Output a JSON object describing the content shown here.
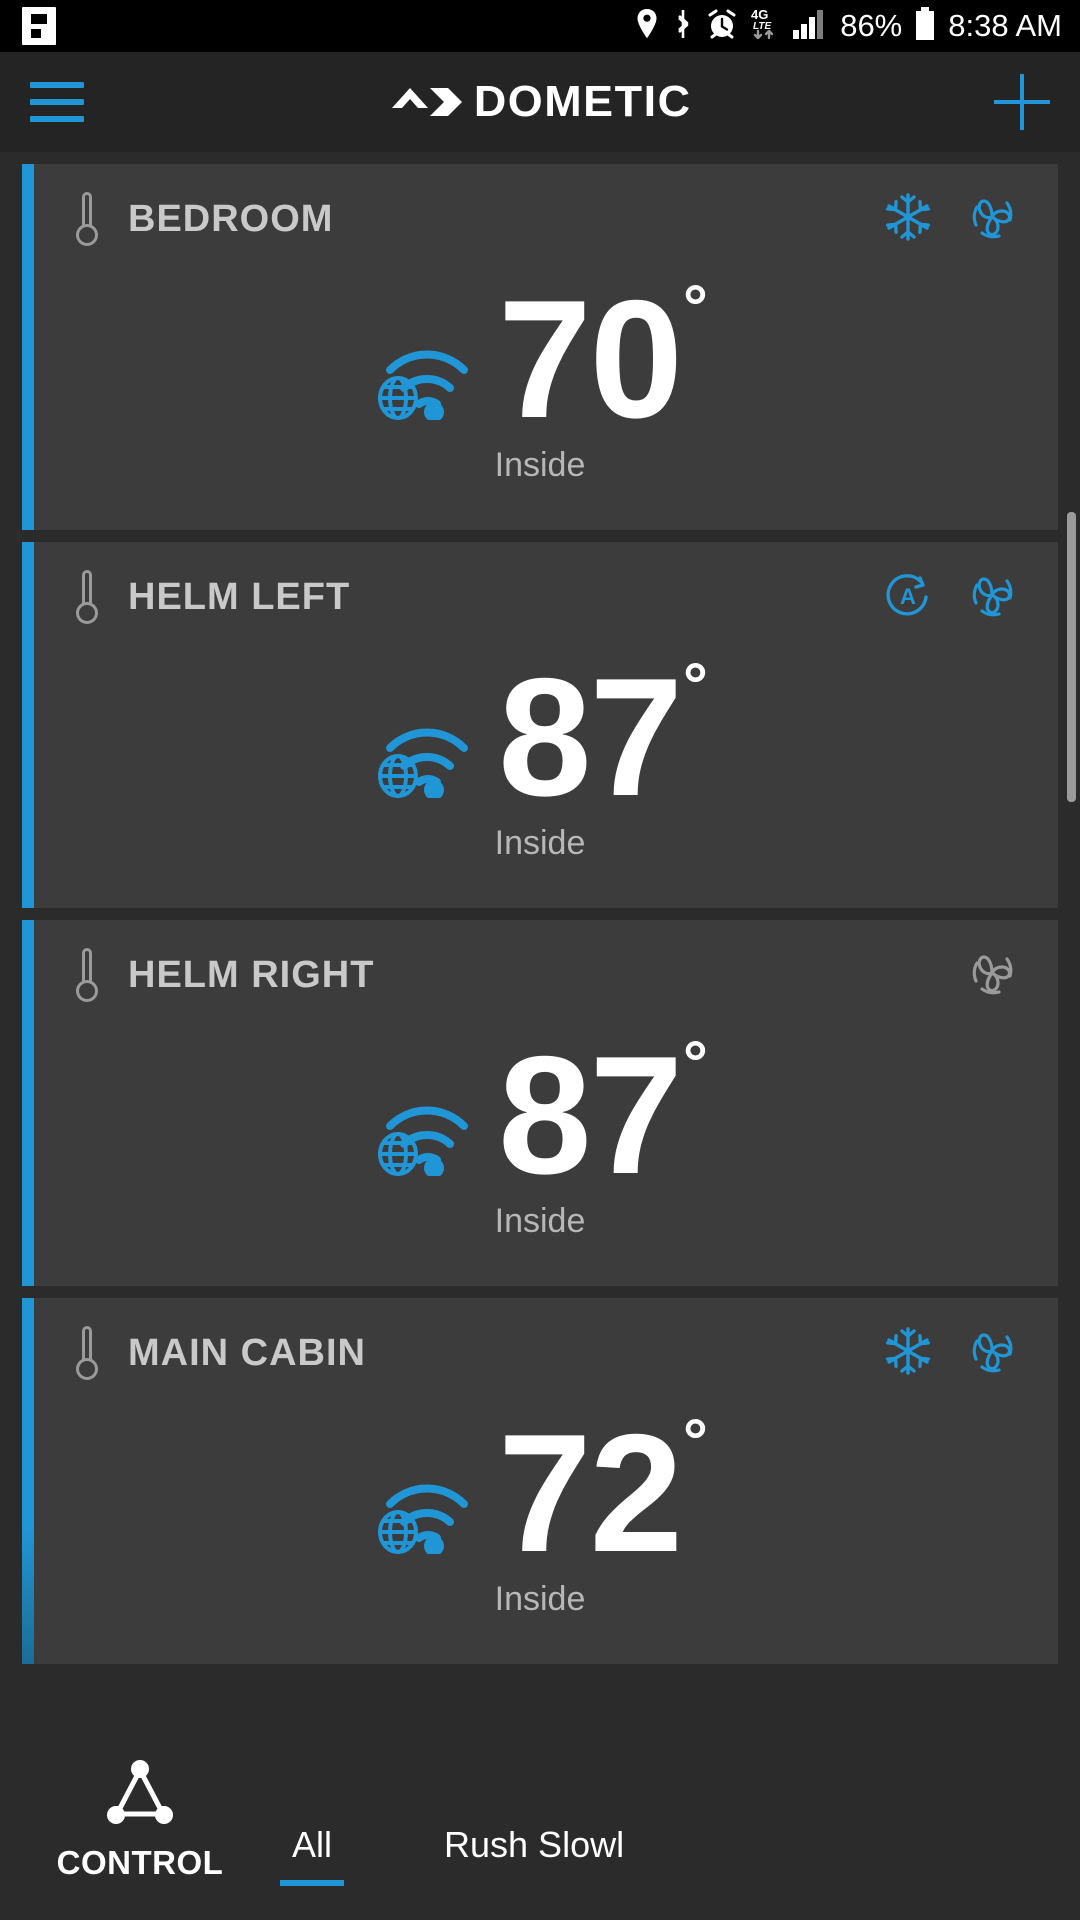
{
  "status_bar": {
    "app_icon": "flipboard-icon",
    "icons": [
      "location-icon",
      "bluetooth-icon",
      "alarm-icon",
      "4g-lte-icon",
      "signal-icon"
    ],
    "network_label": "4G",
    "network_sub": "LTE",
    "battery_percent": "86%",
    "time": "8:38 AM"
  },
  "app_bar": {
    "menu_icon": "hamburger-menu-icon",
    "brand": "DOMETIC",
    "brand_mark": "dometic-chevron-logo",
    "add_icon": "plus-icon"
  },
  "colors": {
    "accent": "#2196d6",
    "card_bg": "#3c3c3c",
    "screen_bg": "#2b2b2b",
    "appbar_bg": "#242424",
    "inactive_icon": "#9a9a9a",
    "title_text": "#c9c9c9"
  },
  "cards": [
    {
      "name": "BEDROOM",
      "temperature": "70",
      "degree": "°",
      "label": "Inside",
      "thermometer_icon": "thermometer-icon",
      "connection_icon": "wifi-globe-icon",
      "mode_icons": [
        {
          "icon": "snowflake-icon",
          "active": true
        },
        {
          "icon": "fan-icon",
          "active": true
        }
      ]
    },
    {
      "name": "HELM LEFT",
      "temperature": "87",
      "degree": "°",
      "label": "Inside",
      "thermometer_icon": "thermometer-icon",
      "connection_icon": "wifi-globe-icon",
      "mode_icons": [
        {
          "icon": "auto-mode-icon",
          "active": true
        },
        {
          "icon": "fan-icon",
          "active": true
        }
      ]
    },
    {
      "name": "HELM RIGHT",
      "temperature": "87",
      "degree": "°",
      "label": "Inside",
      "thermometer_icon": "thermometer-icon",
      "connection_icon": "wifi-globe-icon",
      "mode_icons": [
        {
          "icon": "fan-icon",
          "active": false
        }
      ]
    },
    {
      "name": "MAIN CABIN",
      "temperature": "72",
      "degree": "°",
      "label": "Inside",
      "thermometer_icon": "thermometer-icon",
      "connection_icon": "wifi-globe-icon",
      "mode_icons": [
        {
          "icon": "snowflake-icon",
          "active": true
        },
        {
          "icon": "fan-icon",
          "active": true
        }
      ]
    }
  ],
  "bottom_bar": {
    "control_icon": "triangle-network-icon",
    "control_label": "CONTROL",
    "tabs": [
      {
        "label": "All",
        "active": true
      },
      {
        "label": "Rush Slowl",
        "active": false
      }
    ]
  }
}
